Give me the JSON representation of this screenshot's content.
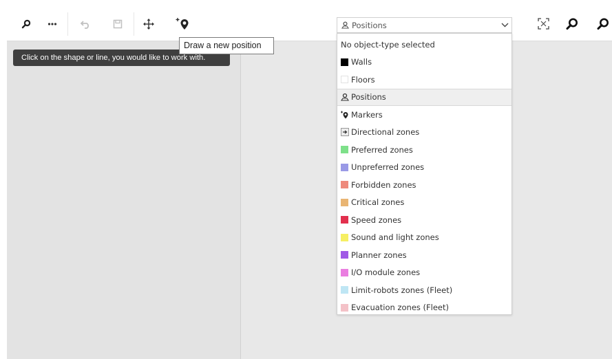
{
  "toolbar": {
    "buttons": [
      {
        "name": "search-icon"
      },
      {
        "name": "more-icon"
      },
      {
        "name": "undo-icon"
      },
      {
        "name": "save-icon"
      },
      {
        "name": "move-icon"
      },
      {
        "name": "add-position-icon"
      }
    ],
    "right_buttons": [
      {
        "name": "fit-screen-icon"
      },
      {
        "name": "zoom-in-icon"
      },
      {
        "name": "zoom-out-icon"
      }
    ]
  },
  "tooltip": "Draw a new position",
  "hint": "Click on the shape or line, you would like to work with.",
  "object_type": {
    "selected": "Positions",
    "options": [
      {
        "label": "No object-type selected",
        "kind": "none"
      },
      {
        "label": "Walls",
        "kind": "swatch",
        "color": "#000000"
      },
      {
        "label": "Floors",
        "kind": "swatch",
        "color": "#ffffff"
      },
      {
        "label": "Positions",
        "kind": "icon",
        "icon": "position-icon",
        "selected": true
      },
      {
        "label": "Markers",
        "kind": "icon",
        "icon": "marker-icon"
      },
      {
        "label": "Directional zones",
        "kind": "icon",
        "icon": "directional-zone-icon"
      },
      {
        "label": "Preferred zones",
        "kind": "swatch",
        "color": "#7ee08a"
      },
      {
        "label": "Unpreferred zones",
        "kind": "swatch",
        "color": "#9a9ae6"
      },
      {
        "label": "Forbidden zones",
        "kind": "swatch",
        "color": "#ee8a7c"
      },
      {
        "label": "Critical zones",
        "kind": "swatch",
        "color": "#e9b573"
      },
      {
        "label": "Speed zones",
        "kind": "swatch",
        "color": "#e2304e"
      },
      {
        "label": "Sound and light zones",
        "kind": "swatch",
        "color": "#f6ef63"
      },
      {
        "label": "Planner zones",
        "kind": "swatch",
        "color": "#a05ae6"
      },
      {
        "label": "I/O module zones",
        "kind": "swatch",
        "color": "#ea7ee0"
      },
      {
        "label": "Limit-robots zones (Fleet)",
        "kind": "swatch",
        "color": "#bfe6f4"
      },
      {
        "label": "Evacuation zones (Fleet)",
        "kind": "swatch",
        "color": "#f4c2c8"
      }
    ]
  }
}
